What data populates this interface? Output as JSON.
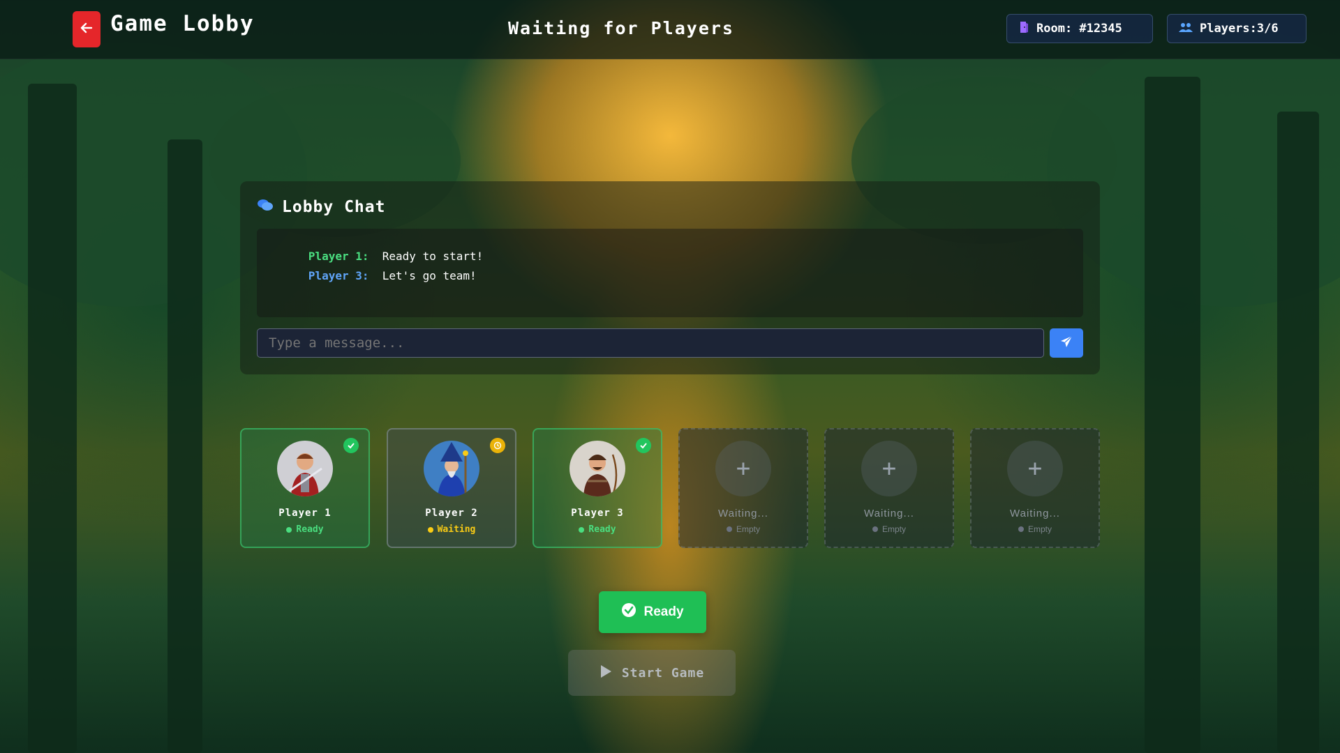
{
  "header": {
    "back_icon": "arrow-left-icon",
    "title": "Game Lobby",
    "subtitle": "Waiting for Players",
    "room_label": "Room: #12345",
    "room_icon": "door-icon",
    "players_label": "Players:3/6",
    "players_icon": "users-icon"
  },
  "chat": {
    "title": "Lobby Chat",
    "icon": "chat-bubbles-icon",
    "messages": [
      {
        "author": "Player 1:",
        "text": "Ready to start!",
        "color": "#4ade80"
      },
      {
        "author": "Player 3:",
        "text": "Let's go team!",
        "color": "#60a5fa"
      }
    ],
    "input_placeholder": "Type a message...",
    "send_icon": "paper-plane-icon"
  },
  "players": [
    {
      "name": "Player 1",
      "status": "Ready",
      "state": "ready",
      "status_color": "#4ade80",
      "badge_icon": "check-icon"
    },
    {
      "name": "Player 2",
      "status": "Waiting",
      "state": "waiting",
      "status_color": "#facc15",
      "badge_icon": "clock-icon"
    },
    {
      "name": "Player 3",
      "status": "Ready",
      "state": "ready",
      "status_color": "#4ade80",
      "badge_icon": "check-icon"
    },
    {
      "name": "Waiting...",
      "status": "Empty",
      "state": "empty",
      "status_color": "#7c848c"
    },
    {
      "name": "Waiting...",
      "status": "Empty",
      "state": "empty",
      "status_color": "#7c848c"
    },
    {
      "name": "Waiting...",
      "status": "Empty",
      "state": "empty",
      "status_color": "#7c848c"
    }
  ],
  "actions": {
    "ready_label": "Ready",
    "start_label": "Start Game"
  },
  "colors": {
    "accent_red": "#e5262a",
    "accent_green": "#1fbf55",
    "accent_blue": "#3b82f6"
  }
}
